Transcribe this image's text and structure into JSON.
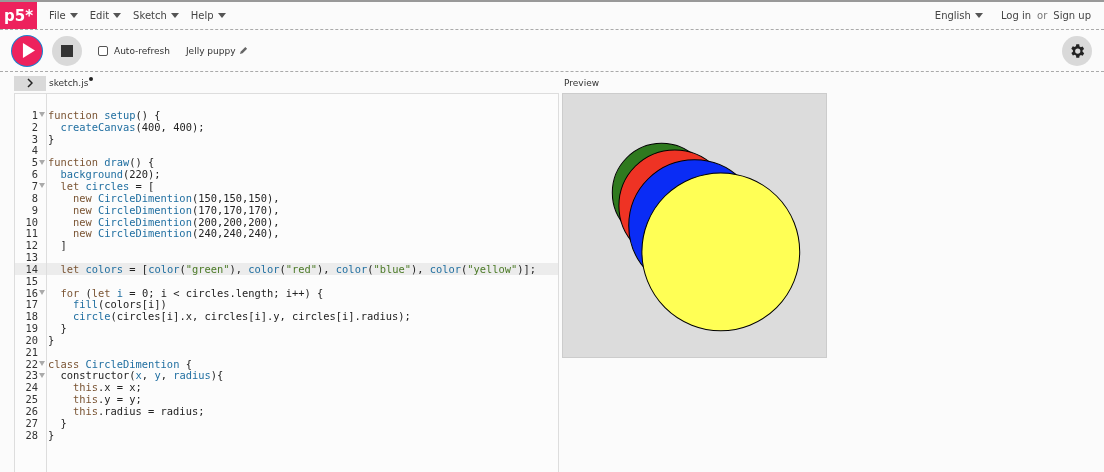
{
  "nav": {
    "logo": "p5*",
    "menus": [
      {
        "label": "File"
      },
      {
        "label": "Edit"
      },
      {
        "label": "Sketch"
      },
      {
        "label": "Help"
      }
    ],
    "language": "English",
    "login": "Log in",
    "or": "or",
    "signup": "Sign up"
  },
  "toolbar": {
    "auto_refresh": {
      "label": "Auto-refresh",
      "checked": false
    },
    "sketch_name": "Jelly puppy"
  },
  "editor": {
    "sidebar_expanded": false,
    "file_tab": {
      "label": "sketch.js",
      "unsaved": true
    },
    "lines": [
      {
        "number": "1",
        "foldable": true,
        "highlighted": false,
        "tokens": [
          {
            "kind": "kw",
            "text": "function "
          },
          {
            "kind": "fn",
            "text": "setup"
          },
          {
            "kind": "plain",
            "text": "() {"
          }
        ]
      },
      {
        "number": "2",
        "foldable": false,
        "highlighted": false,
        "tokens": [
          {
            "kind": "fn",
            "text": "  createCanvas"
          },
          {
            "kind": "plain",
            "text": "(400, 400);"
          }
        ]
      },
      {
        "number": "3",
        "foldable": false,
        "highlighted": false,
        "tokens": [
          {
            "kind": "plain",
            "text": "}"
          }
        ]
      },
      {
        "number": "4",
        "foldable": false,
        "highlighted": false
      },
      {
        "number": "5",
        "foldable": true,
        "highlighted": false,
        "tokens": [
          {
            "kind": "kw",
            "text": "function "
          },
          {
            "kind": "fn",
            "text": "draw"
          },
          {
            "kind": "plain",
            "text": "() {"
          }
        ]
      },
      {
        "number": "6",
        "foldable": false,
        "highlighted": false,
        "tokens": [
          {
            "kind": "fn",
            "text": "  background"
          },
          {
            "kind": "plain",
            "text": "(220);"
          }
        ]
      },
      {
        "number": "7",
        "foldable": true,
        "highlighted": false,
        "tokens": [
          {
            "kind": "kw",
            "text": "  let "
          },
          {
            "kind": "fn",
            "text": "circles"
          },
          {
            "kind": "plain",
            "text": " = ["
          }
        ]
      },
      {
        "number": "8",
        "foldable": false,
        "highlighted": false,
        "tokens": [
          {
            "kind": "kw",
            "text": "    new "
          },
          {
            "kind": "fn",
            "text": "CircleDimention"
          },
          {
            "kind": "plain",
            "text": "(150,150,150),"
          }
        ]
      },
      {
        "number": "9",
        "foldable": false,
        "highlighted": false,
        "tokens": [
          {
            "kind": "kw",
            "text": "    new "
          },
          {
            "kind": "fn",
            "text": "CircleDimention"
          },
          {
            "kind": "plain",
            "text": "(170,170,170),"
          }
        ]
      },
      {
        "number": "10",
        "foldable": false,
        "highlighted": false,
        "tokens": [
          {
            "kind": "kw",
            "text": "    new "
          },
          {
            "kind": "fn",
            "text": "CircleDimention"
          },
          {
            "kind": "plain",
            "text": "(200,200,200),"
          }
        ]
      },
      {
        "number": "11",
        "foldable": false,
        "highlighted": false,
        "tokens": [
          {
            "kind": "kw",
            "text": "    new "
          },
          {
            "kind": "fn",
            "text": "CircleDimention"
          },
          {
            "kind": "plain",
            "text": "(240,240,240),"
          }
        ]
      },
      {
        "number": "12",
        "foldable": false,
        "highlighted": false,
        "tokens": [
          {
            "kind": "plain",
            "text": "  ]"
          }
        ]
      },
      {
        "number": "13",
        "foldable": false,
        "highlighted": false
      },
      {
        "number": "14",
        "foldable": false,
        "highlighted": true,
        "tokens": [
          {
            "kind": "kw",
            "text": "  let "
          },
          {
            "kind": "fn",
            "text": "colors"
          },
          {
            "kind": "plain",
            "text": " = ["
          },
          {
            "kind": "fn",
            "text": "color"
          },
          {
            "kind": "plain",
            "text": "("
          },
          {
            "kind": "str",
            "text": "\"green\""
          },
          {
            "kind": "plain",
            "text": "), "
          },
          {
            "kind": "fn",
            "text": "color"
          },
          {
            "kind": "plain",
            "text": "("
          },
          {
            "kind": "str",
            "text": "\"red\""
          },
          {
            "kind": "plain",
            "text": "), "
          },
          {
            "kind": "fn",
            "text": "color"
          },
          {
            "kind": "plain",
            "text": "("
          },
          {
            "kind": "str",
            "text": "\"blue\""
          },
          {
            "kind": "plain",
            "text": "), "
          },
          {
            "kind": "fn",
            "text": "color"
          },
          {
            "kind": "plain",
            "text": "("
          },
          {
            "kind": "str",
            "text": "\"yellow\""
          },
          {
            "kind": "plain",
            "text": ")];"
          }
        ]
      },
      {
        "number": "15",
        "foldable": false,
        "highlighted": false
      },
      {
        "number": "16",
        "foldable": true,
        "highlighted": false,
        "tokens": [
          {
            "kind": "kw",
            "text": "  for "
          },
          {
            "kind": "plain",
            "text": "("
          },
          {
            "kind": "kw",
            "text": "let "
          },
          {
            "kind": "fn",
            "text": "i"
          },
          {
            "kind": "plain",
            "text": " = 0; i < circles.length; i++) {"
          }
        ]
      },
      {
        "number": "17",
        "foldable": false,
        "highlighted": false,
        "tokens": [
          {
            "kind": "fn",
            "text": "    fill"
          },
          {
            "kind": "plain",
            "text": "(colors[i])"
          }
        ]
      },
      {
        "number": "18",
        "foldable": false,
        "highlighted": false,
        "tokens": [
          {
            "kind": "fn",
            "text": "    circle"
          },
          {
            "kind": "plain",
            "text": "(circles[i].x, circles[i].y, circles[i].radius);"
          }
        ]
      },
      {
        "number": "19",
        "foldable": false,
        "highlighted": false,
        "tokens": [
          {
            "kind": "plain",
            "text": "  }"
          }
        ]
      },
      {
        "number": "20",
        "foldable": false,
        "highlighted": false,
        "tokens": [
          {
            "kind": "plain",
            "text": "}"
          }
        ]
      },
      {
        "number": "21",
        "foldable": false,
        "highlighted": false
      },
      {
        "number": "22",
        "foldable": true,
        "highlighted": false,
        "tokens": [
          {
            "kind": "kw",
            "text": "class "
          },
          {
            "kind": "fn",
            "text": "CircleDimention"
          },
          {
            "kind": "plain",
            "text": " {"
          }
        ]
      },
      {
        "number": "23",
        "foldable": true,
        "highlighted": false,
        "tokens": [
          {
            "kind": "plain",
            "text": "  constructor("
          },
          {
            "kind": "fn",
            "text": "x"
          },
          {
            "kind": "plain",
            "text": ", "
          },
          {
            "kind": "fn",
            "text": "y"
          },
          {
            "kind": "plain",
            "text": ", "
          },
          {
            "kind": "fn",
            "text": "radius"
          },
          {
            "kind": "plain",
            "text": "){"
          }
        ]
      },
      {
        "number": "24",
        "foldable": false,
        "highlighted": false,
        "tokens": [
          {
            "kind": "kw",
            "text": "    this"
          },
          {
            "kind": "plain",
            "text": ".x = x;"
          }
        ]
      },
      {
        "number": "25",
        "foldable": false,
        "highlighted": false,
        "tokens": [
          {
            "kind": "kw",
            "text": "    this"
          },
          {
            "kind": "plain",
            "text": ".y = y;"
          }
        ]
      },
      {
        "number": "26",
        "foldable": false,
        "highlighted": false,
        "tokens": [
          {
            "kind": "kw",
            "text": "    this"
          },
          {
            "kind": "plain",
            "text": ".radius = radius;"
          }
        ]
      },
      {
        "number": "27",
        "foldable": false,
        "highlighted": false,
        "tokens": [
          {
            "kind": "plain",
            "text": "  }"
          }
        ]
      },
      {
        "number": "28",
        "foldable": false,
        "highlighted": false,
        "tokens": [
          {
            "kind": "plain",
            "text": "}"
          }
        ]
      }
    ]
  },
  "preview": {
    "label": "Preview"
  }
}
